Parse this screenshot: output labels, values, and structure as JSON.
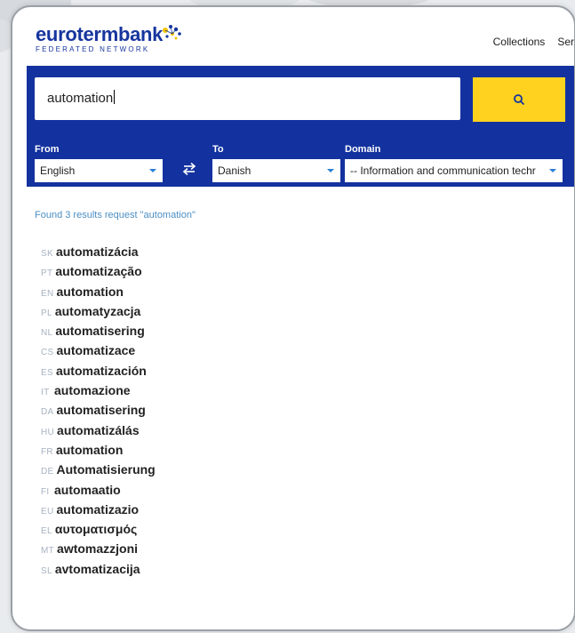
{
  "header": {
    "logo_main": "eurotermbank",
    "logo_sub": "FEDERATED NETWORK",
    "nav": [
      "Collections",
      "Ser"
    ]
  },
  "search": {
    "query": "automation",
    "from_label": "From",
    "from_value": "English",
    "to_label": "To",
    "to_value": "Danish",
    "domain_label": "Domain",
    "domain_value": "-- Information and communication techr"
  },
  "results": {
    "summary": "Found 3 results request \"automation\"",
    "items": [
      {
        "lang": "SK",
        "term": "automatizácia"
      },
      {
        "lang": "PT",
        "term": "automatização"
      },
      {
        "lang": "EN",
        "term": "automation"
      },
      {
        "lang": "PL",
        "term": "automatyzacja"
      },
      {
        "lang": "NL",
        "term": "automatisering"
      },
      {
        "lang": "CS",
        "term": "automatizace"
      },
      {
        "lang": "ES",
        "term": "automatización"
      },
      {
        "lang": "IT",
        "term": "automazione"
      },
      {
        "lang": "DA",
        "term": "automatisering"
      },
      {
        "lang": "HU",
        "term": "automatizálás"
      },
      {
        "lang": "FR",
        "term": "automation"
      },
      {
        "lang": "DE",
        "term": "Automatisierung"
      },
      {
        "lang": "FI",
        "term": "automaatio"
      },
      {
        "lang": "EU",
        "term": "automatizazio"
      },
      {
        "lang": "EL",
        "term": "αυτοματισμός"
      },
      {
        "lang": "MT",
        "term": "awtomazzjoni"
      },
      {
        "lang": "SL",
        "term": "avtomatizacija"
      }
    ]
  },
  "colors": {
    "brand_blue": "#13329f",
    "search_yellow": "#ffd21f",
    "link_blue": "#4d8fc4"
  },
  "icons": [
    "star-cluster-icon",
    "search-icon",
    "swap-arrows-icon",
    "chevron-down-icon"
  ]
}
